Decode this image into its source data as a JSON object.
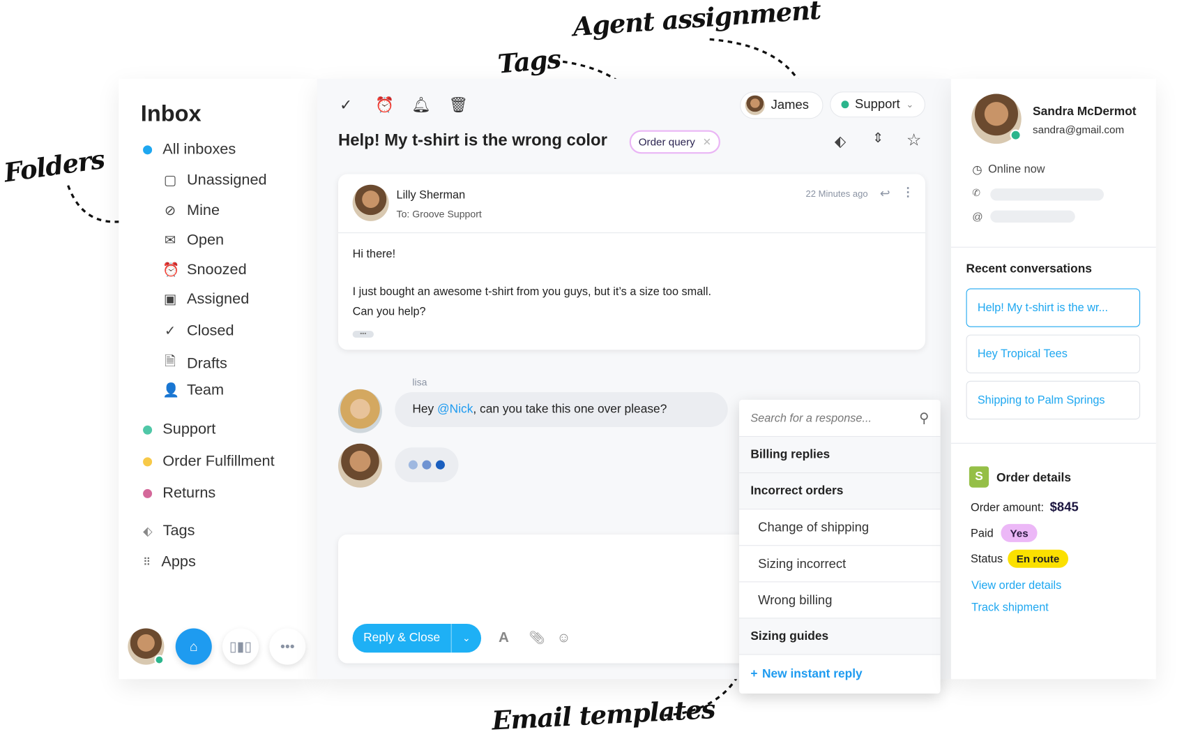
{
  "annotations": {
    "folders": "Folders",
    "tags": "Tags",
    "agent": "Agent assignment",
    "templates": "Email templates"
  },
  "sidebar": {
    "title": "Inbox",
    "all": {
      "label": "All inboxes",
      "color": "#1ea7f0"
    },
    "folders": [
      {
        "label": "Unassigned",
        "icon": "chat-square-icon"
      },
      {
        "label": "Mine",
        "icon": "check-circle-icon"
      },
      {
        "label": "Open",
        "icon": "open-envelope-icon"
      },
      {
        "label": "Snoozed",
        "icon": "alarm-clock-icon"
      },
      {
        "label": "Assigned",
        "icon": "inbox-tray-icon"
      },
      {
        "label": "Closed",
        "icon": "checkmark-icon"
      },
      {
        "label": "Drafts",
        "icon": "draft-document-icon"
      },
      {
        "label": "Team",
        "icon": "person-icon"
      }
    ],
    "mailboxes": [
      {
        "label": "Support",
        "color": "#4fc7a7"
      },
      {
        "label": "Order Fulfillment",
        "color": "#f7c948"
      },
      {
        "label": "Returns",
        "color": "#d4689a"
      }
    ],
    "tags": "Tags",
    "apps": "Apps"
  },
  "conversation": {
    "subject": "Help! My t-shirt is the wrong color",
    "tag": "Order query",
    "assignee": "James",
    "mailbox": "Support",
    "message": {
      "sender": "Lilly Sherman",
      "to": "To: Groove Support",
      "time": "22 Minutes ago",
      "greeting": "Hi there!",
      "line1": "I just bought an awesome t-shirt from you guys, but it’s a size too small.",
      "line2": "Can you help?"
    },
    "note": {
      "author": "lisa",
      "pre": "Hey ",
      "mention": "@Nick",
      "post": ", can you take this one over please?"
    }
  },
  "composer": {
    "reply_label": "Reply & Close"
  },
  "templates": {
    "search_placeholder": "Search for a response...",
    "rows": [
      {
        "label": "Billing replies",
        "type": "head"
      },
      {
        "label": "Incorrect orders",
        "type": "head"
      },
      {
        "label": "Change of shipping",
        "type": "sub"
      },
      {
        "label": "Sizing incorrect",
        "type": "sub"
      },
      {
        "label": "Wrong billing",
        "type": "sub"
      },
      {
        "label": "Sizing guides",
        "type": "head"
      }
    ],
    "new_label": "New instant reply"
  },
  "customer": {
    "name": "Sandra McDermot",
    "email": "sandra@gmail.com",
    "status": "Online now",
    "recent_title": "Recent conversations",
    "recent": [
      "Help! My t-shirt is the wr...",
      "Hey Tropical Tees",
      "Shipping to Palm Springs"
    ],
    "order": {
      "title": "Order details",
      "amount_label": "Order amount:",
      "amount": "$845",
      "paid_label": "Paid",
      "paid": "Yes",
      "status_label": "Status",
      "status": "En route",
      "view": "View order details",
      "track": "Track shipment"
    }
  }
}
